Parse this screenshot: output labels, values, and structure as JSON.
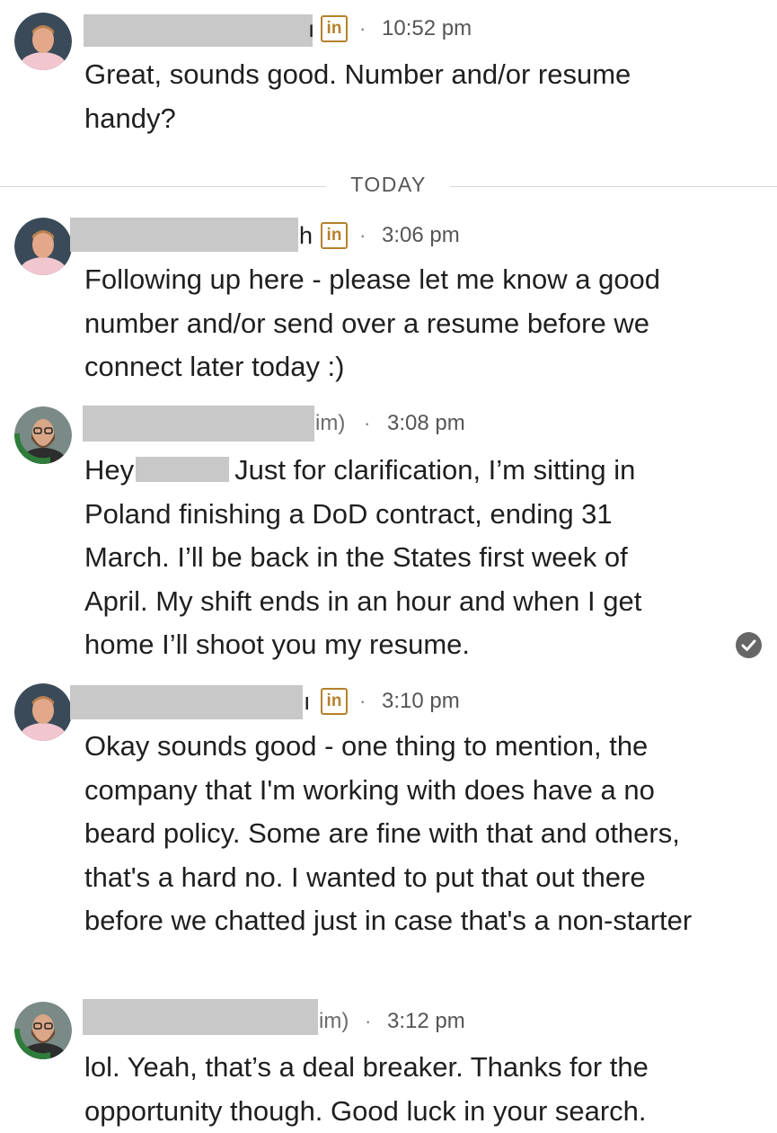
{
  "linkedin_badge": "in",
  "separator_dot": "·",
  "divider": {
    "label": "TODAY"
  },
  "read_receipt_icon": "check-circle-icon",
  "messages": [
    {
      "sender": "recruiter",
      "name_tail": "",
      "time": "10:52 pm",
      "text": "Great, sounds good.  Number and/or resume handy?"
    },
    {
      "sender": "recruiter",
      "name_tail": "h",
      "time": "3:06 pm",
      "text": "Following up here - please let me know a good number and/or send over a resume before we connect later today :)"
    },
    {
      "sender": "candidate",
      "name_tail": "im)",
      "time": "3:08 pm",
      "text_prefix": "Hey",
      "text": "Just for clarification, I’m sitting in Poland finishing a DoD contract, ending 31 March. I’ll be back in the States first week of April. My shift ends in an hour and when I get home I’ll shoot you my resume."
    },
    {
      "sender": "recruiter",
      "name_tail": "",
      "time": "3:10 pm",
      "text": "Okay sounds good - one thing to mention, the company that I'm working with does have a no beard policy.  Some are fine with that and others, that's a hard no.  I wanted to put that out there before we chatted just in case that's a non-starter"
    },
    {
      "sender": "candidate",
      "name_tail": "im)",
      "time": "3:12 pm",
      "text": "lol. Yeah, that’s a deal breaker. Thanks for the opportunity though. Good luck in your search."
    }
  ]
}
